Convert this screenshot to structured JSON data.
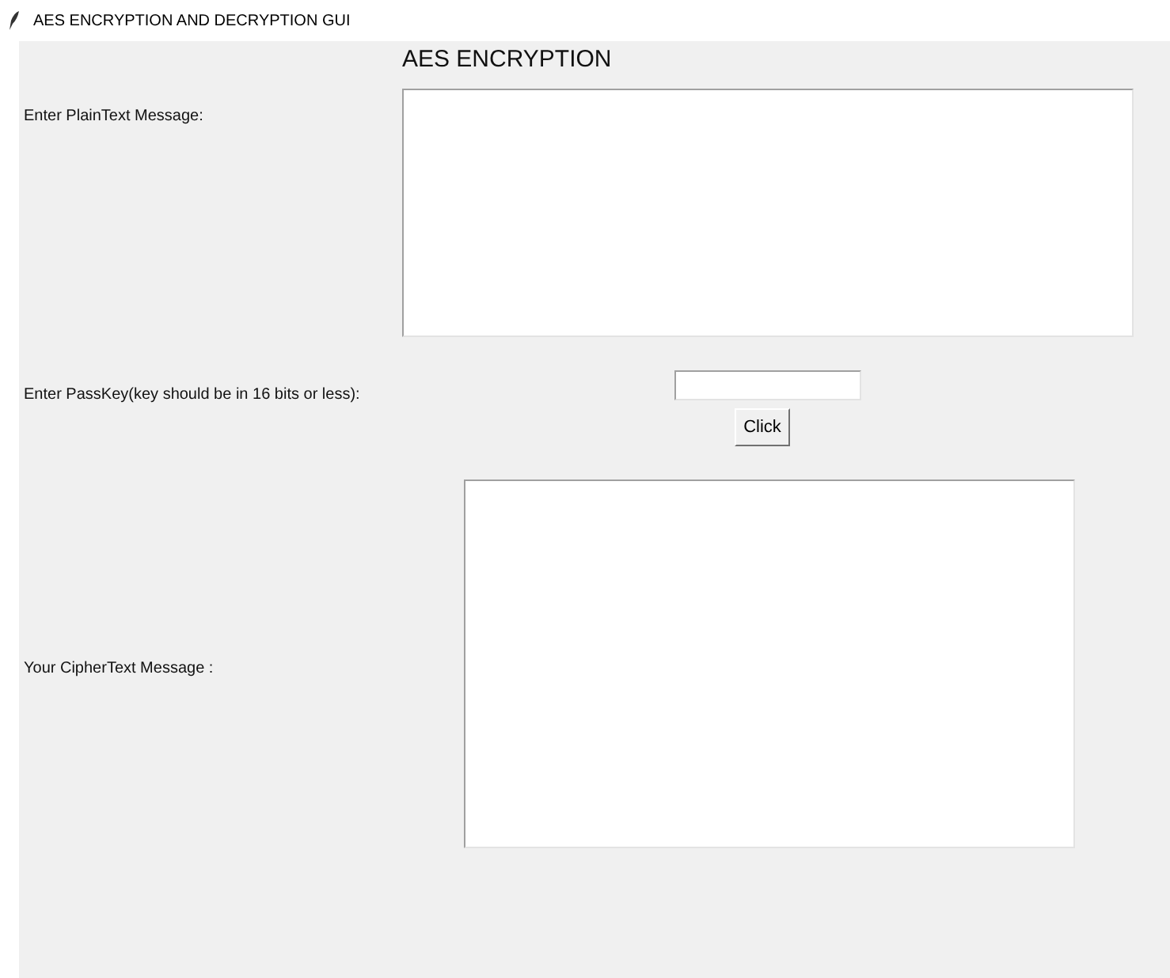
{
  "window": {
    "title": "AES ENCRYPTION AND DECRYPTION GUI"
  },
  "heading": "AES ENCRYPTION",
  "plaintext": {
    "label": "Enter PlainText Message:"
  },
  "passkey": {
    "label": "Enter PassKey(key should be in 16 bits or less):"
  },
  "button": "Click",
  "ciphertext": {
    "label": "Your CipherText Message :"
  }
}
